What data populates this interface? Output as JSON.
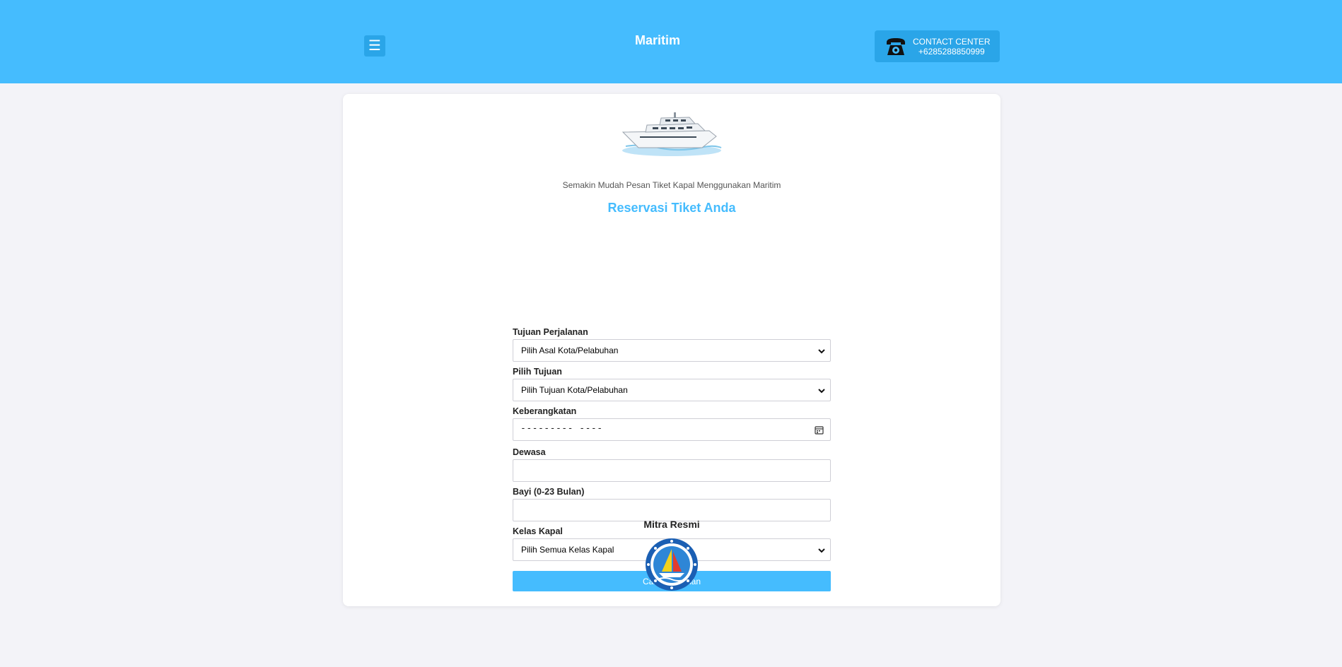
{
  "header": {
    "menu_glyph": "☰",
    "brand": "Maritim",
    "contact_label": "CONTACT CENTER",
    "contact_phone": "+6285288850999",
    "background_color": "#45bcfe"
  },
  "hero": {
    "tagline": "Semakin Mudah Pesan Tiket Kapal Menggunakan Maritim",
    "title": "Reservasi Tiket Anda"
  },
  "form": {
    "origin_label": "Tujuan Perjalanan",
    "origin_value": "Pilih Asal Kota/Pelabuhan",
    "destination_label": "Pilih Tujuan",
    "destination_value": "Pilih Tujuan Kota/Pelabuhan",
    "departure_label": "Keberangkatan",
    "departure_placeholder": "---------  ----",
    "adult_label": "Dewasa",
    "adult_value": "",
    "infant_label": "Bayi (0-23 Bulan)",
    "infant_value": "",
    "class_label": "Kelas Kapal",
    "class_value": "Pilih Semua Kelas Kapal",
    "submit_label": "Cari Pelayanan"
  },
  "partners": {
    "title": "Mitra Resmi"
  },
  "icons": {
    "menu": "hamburger-menu-icon",
    "phone": "telephone-icon",
    "dropdown": "chevron-down-icon",
    "calendar": "calendar-icon"
  },
  "colors": {
    "accent": "#45bcfe",
    "accent_dark": "#2aa5e8",
    "page_background": "#f3f3f8"
  }
}
